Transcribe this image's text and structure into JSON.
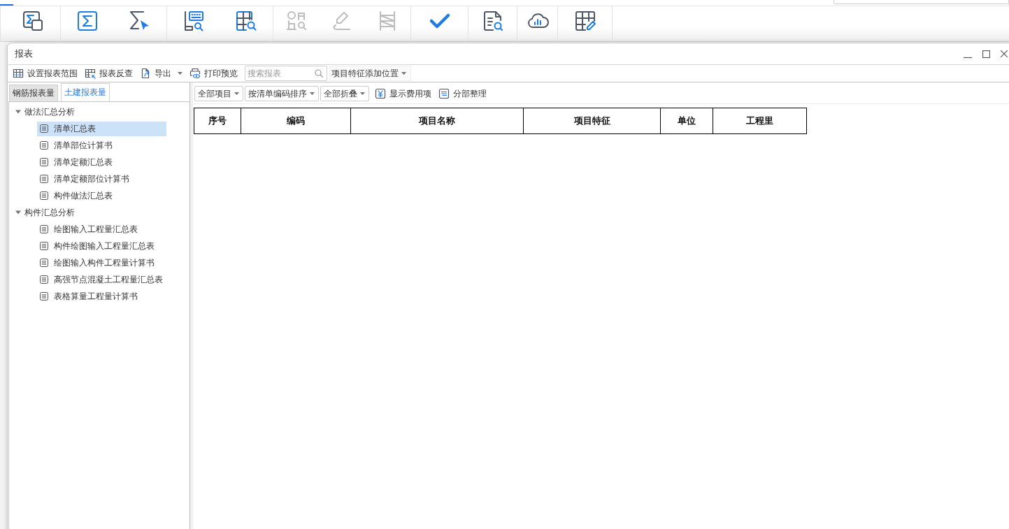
{
  "ribbon": {
    "groups": [
      {
        "tools": [
          {
            "disabled": false
          }
        ]
      },
      {
        "tools": [
          {
            "disabled": false
          },
          {
            "disabled": false
          }
        ]
      },
      {
        "tools": [
          {
            "disabled": false
          },
          {
            "disabled": false
          }
        ]
      },
      {
        "tools": [
          {
            "disabled": true
          },
          {
            "disabled": true
          },
          {
            "disabled": true
          }
        ]
      },
      {
        "tools": [
          {
            "disabled": false
          }
        ]
      },
      {
        "tools": [
          {
            "disabled": false
          }
        ]
      },
      {
        "tools": [
          {
            "disabled": false
          }
        ]
      },
      {
        "tools": [
          {
            "disabled": false
          }
        ]
      }
    ]
  },
  "dialog": {
    "title": "报表",
    "toolbar": [
      {
        "kind": "button",
        "label": "设置报表范围"
      },
      {
        "kind": "button",
        "label": "报表反查"
      },
      {
        "kind": "menu",
        "label": "导出"
      },
      {
        "kind": "button",
        "label": "打印预览"
      },
      {
        "kind": "search",
        "placeholder": "搜索报表"
      },
      {
        "kind": "dropdown",
        "label": "项目特征添加位置"
      }
    ],
    "tabs": [
      {
        "label": "钢筋报表量",
        "selected": false
      },
      {
        "label": "土建报表量",
        "selected": true
      }
    ],
    "tree": [
      {
        "label": "做法汇总分析",
        "expanded": true,
        "children": [
          {
            "label": "清单汇总表",
            "selected": true
          },
          {
            "label": "清单部位计算书",
            "selected": false
          },
          {
            "label": "清单定额汇总表",
            "selected": false
          },
          {
            "label": "清单定额部位计算书",
            "selected": false
          },
          {
            "label": "构件做法汇总表",
            "selected": false
          }
        ]
      },
      {
        "label": "构件汇总分析",
        "expanded": true,
        "children": [
          {
            "label": "绘图输入工程量汇总表",
            "selected": false
          },
          {
            "label": "构件绘图输入工程量汇总表",
            "selected": false
          },
          {
            "label": "绘图输入构件工程量计算书",
            "selected": false
          },
          {
            "label": "高强节点混凝土工程量汇总表",
            "selected": false
          },
          {
            "label": "表格算量工程量计算书",
            "selected": false
          }
        ]
      }
    ],
    "filters": [
      {
        "kind": "dropdown",
        "label": "全部项目"
      },
      {
        "kind": "dropdown",
        "label": "按清单编码排序"
      },
      {
        "kind": "dropdown",
        "label": "全部折叠"
      },
      {
        "kind": "button",
        "label": "显示费用项"
      },
      {
        "kind": "button",
        "label": "分部整理"
      }
    ],
    "table": {
      "columns": [
        "序号",
        "编码",
        "项目名称",
        "项目特征",
        "单位",
        "工程里"
      ]
    }
  }
}
